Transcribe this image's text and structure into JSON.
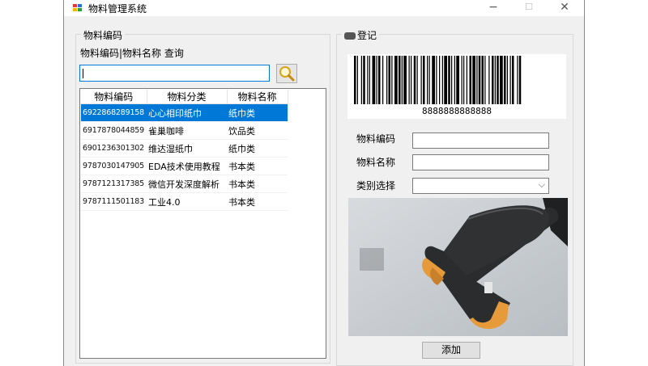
{
  "window": {
    "title": "物料管理系统",
    "minimize": "−",
    "maximize": "☐",
    "close": "✕"
  },
  "left_panel": {
    "group_title": "物料编码",
    "search_label": "物料编码|物料名称 查询",
    "search_value": "",
    "search_icon": "magnifier-icon",
    "columns": [
      "物料编码",
      "物料分类",
      "物料名称"
    ],
    "rows": [
      {
        "code": "6922868289158",
        "category": "心心相印纸巾",
        "name": "纸巾类",
        "selected": true
      },
      {
        "code": "6917878044859",
        "category": "雀巢咖啡",
        "name": "饮品类",
        "selected": false
      },
      {
        "code": "6901236301302",
        "category": "维达湿纸巾",
        "name": "纸巾类",
        "selected": false
      },
      {
        "code": "9787030147905",
        "category": "EDA技术使用教程",
        "name": "书本类",
        "selected": false
      },
      {
        "code": "9787121317385",
        "category": "微信开发深度解析",
        "name": "书本类",
        "selected": false
      },
      {
        "code": "9787111501183",
        "category": "工业4.0",
        "name": "书本类",
        "selected": false
      }
    ]
  },
  "right_panel": {
    "group_title": "登记",
    "barcode_number": "8888888888888",
    "fields": {
      "code_label": "物料编码",
      "code_value": "",
      "name_label": "物料名称",
      "name_value": "",
      "category_label": "类别选择",
      "category_value": ""
    },
    "add_button": "添加"
  },
  "colors": {
    "selection": "#0078d7",
    "window_bg": "#f0f0f0",
    "scanner_body": "#2a2c2e",
    "scanner_accent": "#e69a3a"
  }
}
